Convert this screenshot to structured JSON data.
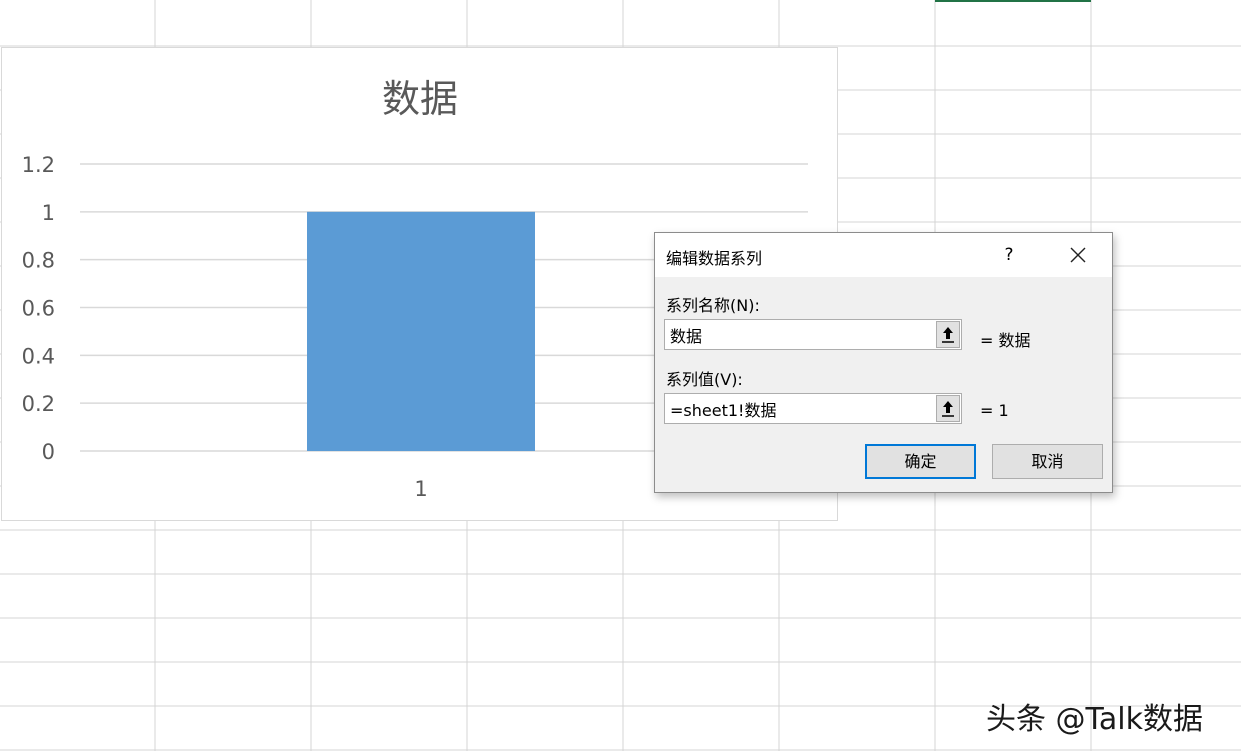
{
  "chart_data": {
    "type": "bar",
    "title": "数据",
    "categories": [
      "1"
    ],
    "series": [
      {
        "values": [
          1
        ]
      }
    ],
    "ylim": [
      0,
      1.2
    ],
    "yticks": [
      "0",
      "0.2",
      "0.4",
      "0.6",
      "0.8",
      "1",
      "1.2"
    ],
    "grid": true,
    "bar_color": "#5b9bd5"
  },
  "dialog": {
    "title": "编辑数据系列",
    "help_label": "?",
    "close_icon": "close-icon",
    "series_name_label": "系列名称(N):",
    "series_name_value": "数据",
    "series_name_preview": "= 数据",
    "series_values_label": "系列值(V):",
    "series_values_value": "=sheet1!数据",
    "series_values_preview": "= 1",
    "collapse_icon": "range-collapse-icon",
    "ok_label": "确定",
    "cancel_label": "取消",
    "accent_color": "#0078d7"
  },
  "sheet": {
    "selection_color": "#217346"
  },
  "watermark": "头条 @Talk数据"
}
